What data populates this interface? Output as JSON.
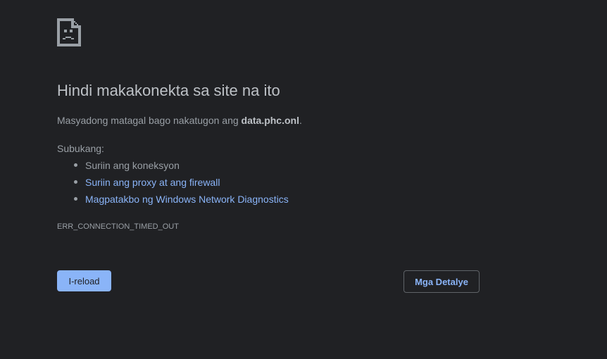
{
  "error_page": {
    "icon": "sad-document-icon",
    "title": "Hindi makakonekta sa site na ito",
    "summary_prefix": "Masyadong matagal bago nakatugon ang ",
    "host": "data.phc.onl",
    "summary_suffix": ".",
    "suggestions_label": "Subukang:",
    "suggestions": [
      {
        "text": "Suriin ang koneksyon",
        "is_link": false
      },
      {
        "text": "Suriin ang proxy at ang firewall",
        "is_link": true
      },
      {
        "text": "Magpatakbo ng Windows Network Diagnostics",
        "is_link": true
      }
    ],
    "error_code": "ERR_CONNECTION_TIMED_OUT",
    "reload_label": "I-reload",
    "details_label": "Mga Detalye"
  },
  "colors": {
    "background": "#202124",
    "text": "#9aa0a6",
    "heading": "#bdc1c6",
    "link": "#8ab4f8",
    "button_primary": "#8ab4f8"
  }
}
